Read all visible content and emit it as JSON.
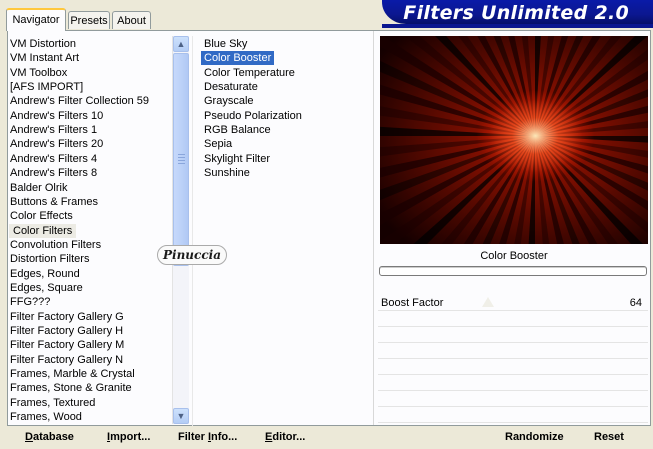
{
  "tabs": [
    {
      "label": "Navigator",
      "active": true
    },
    {
      "label": "Presets",
      "active": false
    },
    {
      "label": "About",
      "active": false
    }
  ],
  "banner": {
    "title": "Filters Unlimited 2.0"
  },
  "categories": [
    {
      "label": "VM Distortion"
    },
    {
      "label": "VM Instant Art"
    },
    {
      "label": "VM Toolbox"
    },
    {
      "label": "[AFS IMPORT]"
    },
    {
      "label": "Andrew's Filter Collection 59"
    },
    {
      "label": "Andrew's Filters 10"
    },
    {
      "label": "Andrew's Filters 1"
    },
    {
      "label": "Andrew's Filters 20"
    },
    {
      "label": "Andrew's Filters 4"
    },
    {
      "label": "Andrew's Filters 8"
    },
    {
      "label": "Balder Olrik"
    },
    {
      "label": "Buttons & Frames"
    },
    {
      "label": "Color Effects"
    },
    {
      "label": "Color Filters",
      "selected": true
    },
    {
      "label": "Convolution Filters"
    },
    {
      "label": "Distortion Filters"
    },
    {
      "label": "Edges, Round"
    },
    {
      "label": "Edges, Square"
    },
    {
      "label": "FFG???"
    },
    {
      "label": "Filter Factory Gallery G"
    },
    {
      "label": "Filter Factory Gallery H"
    },
    {
      "label": "Filter Factory Gallery M"
    },
    {
      "label": "Filter Factory Gallery N"
    },
    {
      "label": "Frames, Marble & Crystal"
    },
    {
      "label": "Frames, Stone & Granite"
    },
    {
      "label": "Frames, Textured"
    },
    {
      "label": "Frames, Wood"
    }
  ],
  "filters": [
    {
      "label": "Blue Sky"
    },
    {
      "label": "Color Booster",
      "selected": true
    },
    {
      "label": "Color Temperature"
    },
    {
      "label": "Desaturate"
    },
    {
      "label": "Grayscale"
    },
    {
      "label": "Pseudo Polarization"
    },
    {
      "label": "RGB Balance"
    },
    {
      "label": "Sepia"
    },
    {
      "label": "Skylight Filter"
    },
    {
      "label": "Sunshine"
    }
  ],
  "scrollbar": {
    "up_glyph": "▲",
    "down_glyph": "▼"
  },
  "preview": {
    "filter_name": "Color Booster",
    "progress": 0.0
  },
  "parameters": [
    {
      "label": "Boost Factor",
      "value": "64",
      "slider_fraction": 0.25
    }
  ],
  "watermark": {
    "text": "Pinuccia"
  },
  "buttons": {
    "database": {
      "prefix": "",
      "accel": "D",
      "rest": "atabase"
    },
    "import": {
      "prefix": "",
      "accel": "I",
      "rest": "mport..."
    },
    "filter_info": {
      "prefix": "Filter ",
      "accel": "I",
      "rest": "nfo..."
    },
    "editor": {
      "prefix": "",
      "accel": "E",
      "rest": "ditor..."
    },
    "randomize": {
      "prefix": "",
      "accel": "",
      "rest": "Randomize"
    },
    "reset": {
      "prefix": "",
      "accel": "",
      "rest": "Reset"
    }
  },
  "colors": {
    "accent": "#316ac5",
    "banner": "#0b1790",
    "tab_highlight": "#ffc83c"
  }
}
